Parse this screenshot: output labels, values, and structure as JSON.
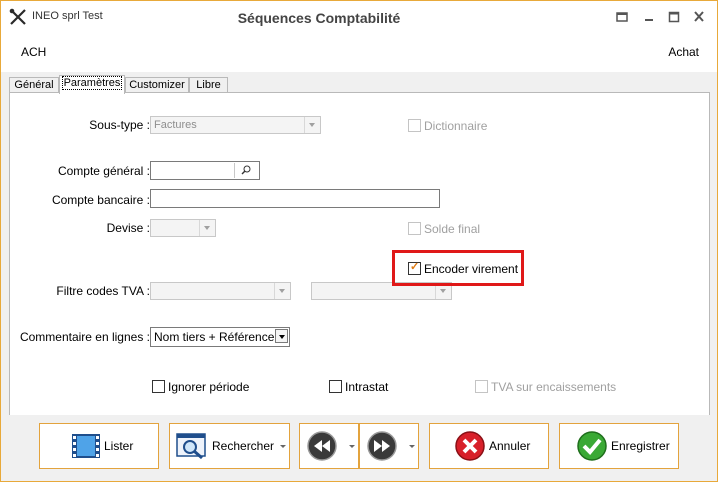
{
  "window": {
    "app_title": "INEO sprl Test",
    "title": "Séquences Comptabilité",
    "code": "ACH",
    "type": "Achat"
  },
  "tabs": [
    "Général",
    "Paramètres",
    "Customizer",
    "Libre"
  ],
  "active_tab": "Paramètres",
  "form": {
    "sous_type_label": "Sous-type :",
    "sous_type_value": "Factures",
    "dictionnaire_label": "Dictionnaire",
    "compte_general_label": "Compte général :",
    "compte_general_value": "",
    "compte_bancaire_label": "Compte bancaire :",
    "compte_bancaire_value": "",
    "devise_label": "Devise :",
    "devise_value": "",
    "solde_final_label": "Solde final",
    "encoder_virement_label": "Encoder virement",
    "encoder_virement_checked": true,
    "filtre_tva_label": "Filtre codes TVA :",
    "filtre_tva_value1": "",
    "filtre_tva_value2": "",
    "commentaire_label": "Commentaire en lignes :",
    "commentaire_value": "Nom tiers + Référence",
    "ignorer_periode_label": "Ignorer période",
    "intrastat_label": "Intrastat",
    "tva_encaissements_label": "TVA sur encaissements"
  },
  "buttons": {
    "lister": "Lister",
    "rechercher": "Rechercher",
    "annuler": "Annuler",
    "enregistrer": "Enregistrer"
  },
  "colors": {
    "accent_border": "#e3a33d",
    "highlight": "#e01818",
    "check_mark": "#e07b12"
  }
}
